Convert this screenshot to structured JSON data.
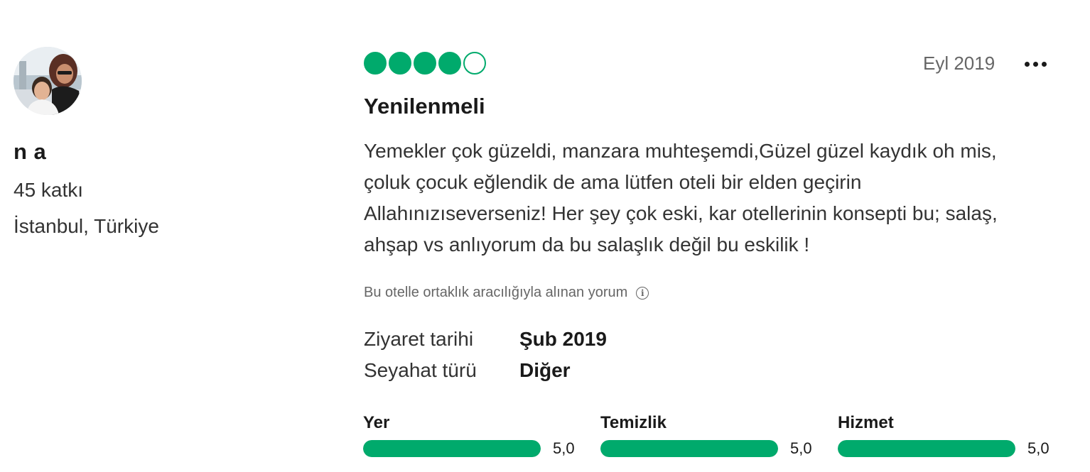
{
  "reviewer": {
    "name": "n a",
    "contributions": "45 katkı",
    "location": "İstanbul, Türkiye"
  },
  "review": {
    "rating": 4,
    "rating_max": 5,
    "date": "Eyl 2019",
    "title": "Yenilenmeli",
    "body": "Yemekler çok güzeldi, manzara muhteşemdi,Güzel güzel kaydık oh mis, çoluk çocuk eğlendik de ama lütfen oteli bir elden geçirin Allahınızıseverseniz! Her şey çok eski, kar otellerinin konsepti bu; salaş, ahşap vs anlıyorum da bu salaşlık değil bu eskilik !",
    "disclaimer": "Bu otelle ortaklık aracılığıyla alınan yorum",
    "more_icon": "ellipsis-icon",
    "info_icon": "info-icon"
  },
  "details": {
    "visit_label": "Ziyaret tarihi",
    "visit_value": "Şub 2019",
    "trip_label": "Seyahat türü",
    "trip_value": "Diğer"
  },
  "sub_ratings": [
    {
      "label": "Yer",
      "score": "5,0",
      "value": 5.0
    },
    {
      "label": "Temizlik",
      "score": "5,0",
      "value": 5.0
    },
    {
      "label": "Hizmet",
      "score": "5,0",
      "value": 5.0
    }
  ],
  "colors": {
    "accent": "#00aa6c"
  }
}
